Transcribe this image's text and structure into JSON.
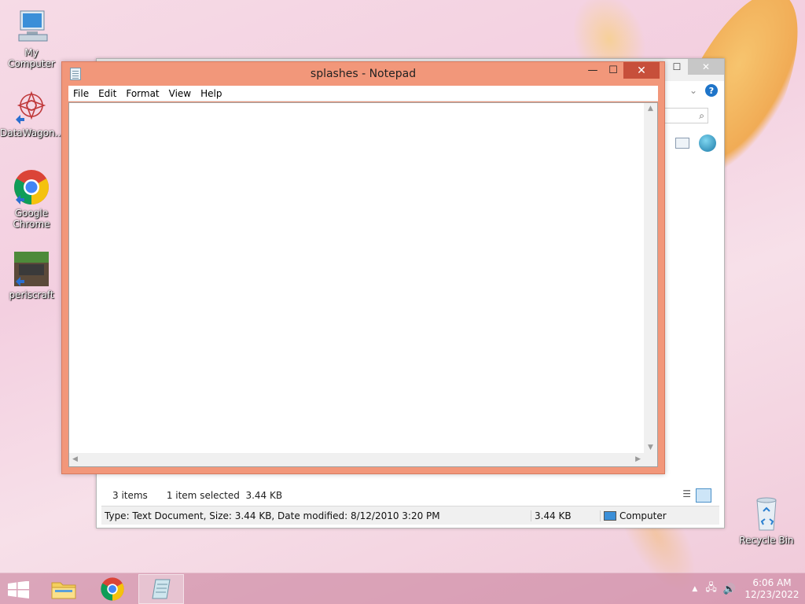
{
  "desktop": {
    "icons": [
      {
        "label": "My Computer"
      },
      {
        "label": "DataWagon..."
      },
      {
        "label": "Google Chrome"
      },
      {
        "label": "periscraft"
      },
      {
        "label": "Recycle Bin"
      }
    ]
  },
  "explorer": {
    "status": {
      "items_count": "3 items",
      "selected": "1 item selected  3.44 KB"
    },
    "details": {
      "info": "Type: Text Document, Size: 3.44 KB, Date modified: 8/12/2010 3:20 PM",
      "size": "3.44 KB",
      "location": "Computer"
    }
  },
  "notepad": {
    "title": "splashes - Notepad",
    "menu": [
      "File",
      "Edit",
      "Format",
      "View",
      "Help"
    ],
    "content": ""
  },
  "taskbar": {
    "time": "6:06 AM",
    "date": "12/23/2022"
  },
  "colors": {
    "notepad_frame": "#f2977a",
    "close_button": "#c74f3a"
  }
}
